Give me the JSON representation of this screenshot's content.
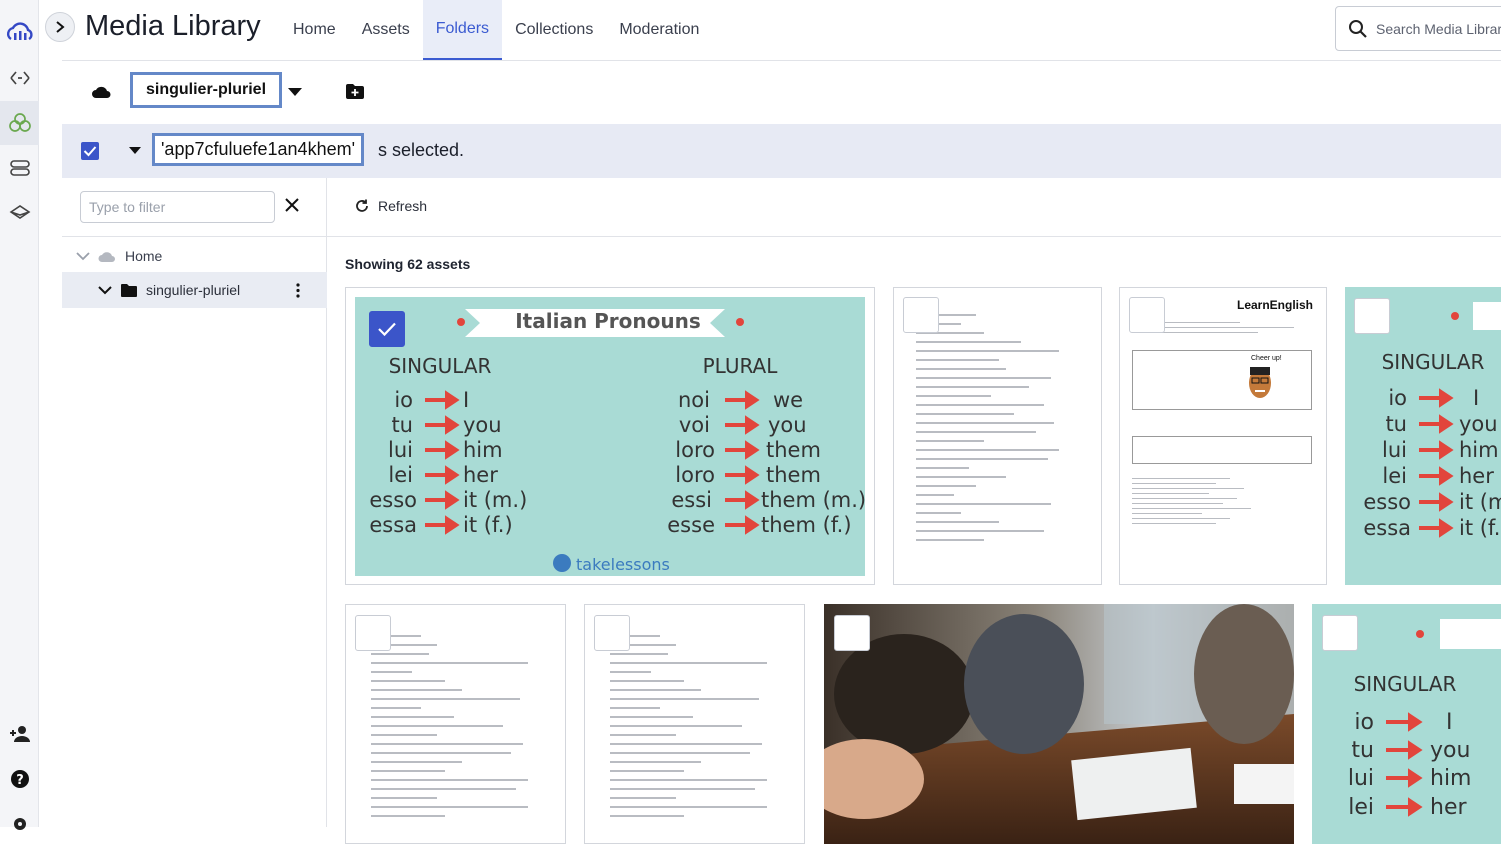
{
  "app": {
    "title": "Media Library"
  },
  "nav": {
    "tabs": [
      {
        "label": "Home"
      },
      {
        "label": "Assets"
      },
      {
        "label": "Folders"
      },
      {
        "label": "Collections"
      },
      {
        "label": "Moderation"
      }
    ],
    "active": "Folders"
  },
  "search": {
    "placeholder": "Search Media Library"
  },
  "breadcrumb": {
    "folder": "singulier-pluriel"
  },
  "selection": {
    "asset_id": "'app7cfuluefe1an4khem'",
    "suffix": "s selected."
  },
  "sidebar": {
    "filter_placeholder": "Type to filter",
    "tree": {
      "home": "Home",
      "folder": "singulier-pluriel"
    }
  },
  "main": {
    "refresh_label": "Refresh",
    "showing_label": "Showing 62 assets"
  },
  "cards": {
    "pronouns": {
      "title": "Italian Pronouns",
      "singular_header": "SINGULAR",
      "plural_header": "PLURAL",
      "singular": [
        {
          "it": "io",
          "en": "I"
        },
        {
          "it": "tu",
          "en": "you"
        },
        {
          "it": "lui",
          "en": "him"
        },
        {
          "it": "lei",
          "en": "her"
        },
        {
          "it": "esso",
          "en": "it (m.)"
        },
        {
          "it": "essa",
          "en": "it (f.)"
        }
      ],
      "plural": [
        {
          "it": "noi",
          "en": "we"
        },
        {
          "it": "voi",
          "en": "you"
        },
        {
          "it": "loro",
          "en": "them"
        },
        {
          "it": "loro",
          "en": "them"
        },
        {
          "it": "essi",
          "en": "them (m.)"
        },
        {
          "it": "esse",
          "en": "them (f.)"
        }
      ],
      "brand": "takelessons"
    },
    "learnenglish": {
      "brand": "LearnEnglish",
      "bubble": "Cheer up!"
    }
  },
  "colors": {
    "accent": "#3b5bd1",
    "checkbox": "#3b55c9",
    "teal": "#a9dbd5",
    "arrow": "#e2453c"
  }
}
